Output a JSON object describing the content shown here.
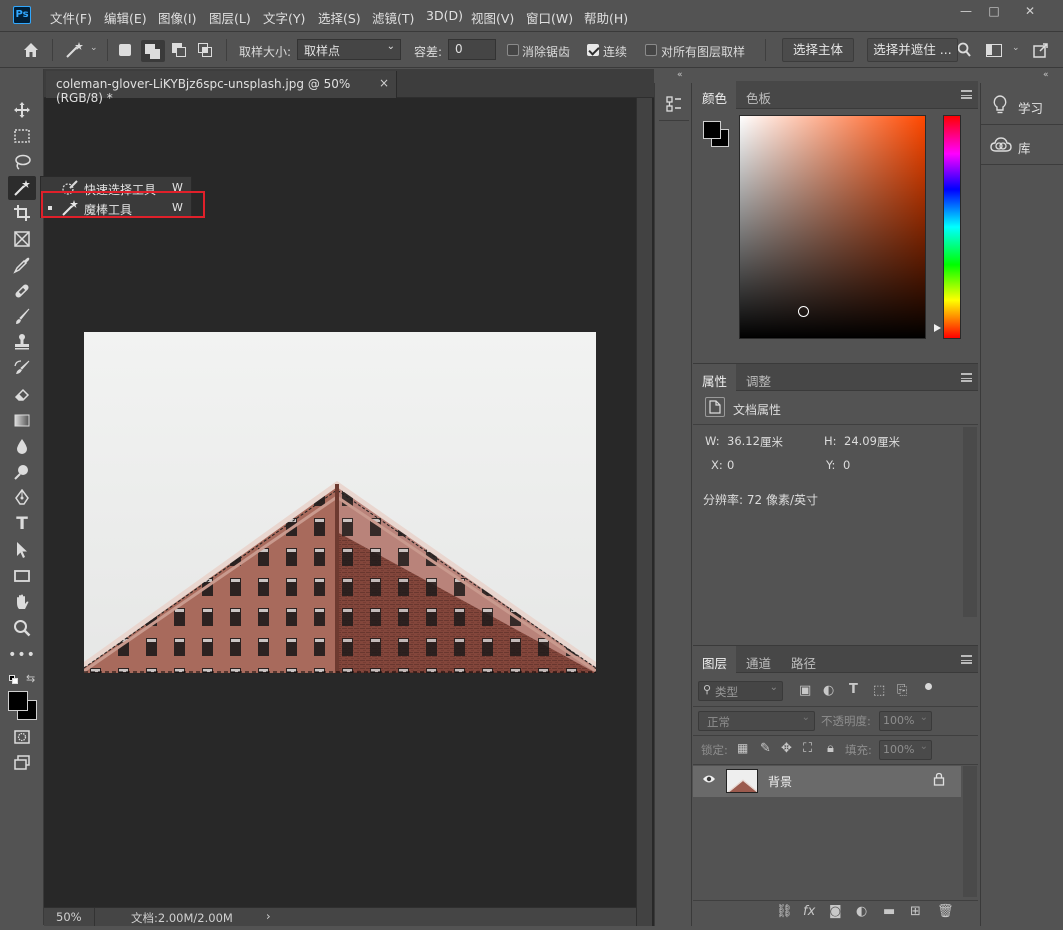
{
  "app": {
    "logo": "Ps"
  },
  "menu": [
    "文件(F)",
    "编辑(E)",
    "图像(I)",
    "图层(L)",
    "文字(Y)",
    "选择(S)",
    "滤镜(T)",
    "3D(D)",
    "视图(V)",
    "窗口(W)",
    "帮助(H)"
  ],
  "window_controls": {
    "minimize": "—",
    "maximize": "□",
    "close": "✕"
  },
  "options": {
    "sample_size_label": "取样大小:",
    "sample_size_value": "取样点",
    "tolerance_label": "容差:",
    "tolerance_value": "0",
    "antialias_label": "消除锯齿",
    "antialias_checked": false,
    "contiguous_label": "连续",
    "contiguous_checked": true,
    "all_layers_label": "对所有图层取样",
    "all_layers_checked": false,
    "select_subject": "选择主体",
    "select_and_mask": "选择并遮住 ..."
  },
  "document": {
    "tab_title": "coleman-glover-LiKYBjz6spc-unsplash.jpg @ 50%(RGB/8) *",
    "tab_close": "×"
  },
  "flyout": {
    "items": [
      {
        "label": "快速选择工具",
        "shortcut": "W",
        "selected": false
      },
      {
        "label": "魔棒工具",
        "shortcut": "W",
        "selected": true
      }
    ]
  },
  "status": {
    "zoom": "50%",
    "doc_info": "文档:2.00M/2.00M",
    "arrow": "›"
  },
  "color_panel": {
    "tabs": [
      "颜色",
      "色板"
    ],
    "field_hue_color": "#ff4800",
    "foreground": "#000000",
    "background": "#000000"
  },
  "properties_panel": {
    "tabs": [
      "属性",
      "调整"
    ],
    "section_title": "文档属性",
    "w_label": "W:",
    "w_value": "36.12",
    "w_unit": "厘米",
    "h_label": "H:",
    "h_value": "24.09",
    "h_unit": "厘米",
    "x_label": "X:",
    "x_value": "0",
    "y_label": "Y:",
    "y_value": "0",
    "resolution": "分辨率: 72 像素/英寸"
  },
  "layers_panel": {
    "tabs": [
      "图层",
      "通道",
      "路径"
    ],
    "filter_placeholder": "类型",
    "blend_mode": "正常",
    "opacity_label": "不透明度:",
    "opacity_value": "100%",
    "lock_label": "锁定:",
    "fill_label": "填充:",
    "fill_value": "100%",
    "layers": [
      {
        "name": "背景",
        "visible": true,
        "locked": true
      }
    ]
  },
  "right_dock": {
    "items": [
      "学习",
      "库"
    ]
  }
}
